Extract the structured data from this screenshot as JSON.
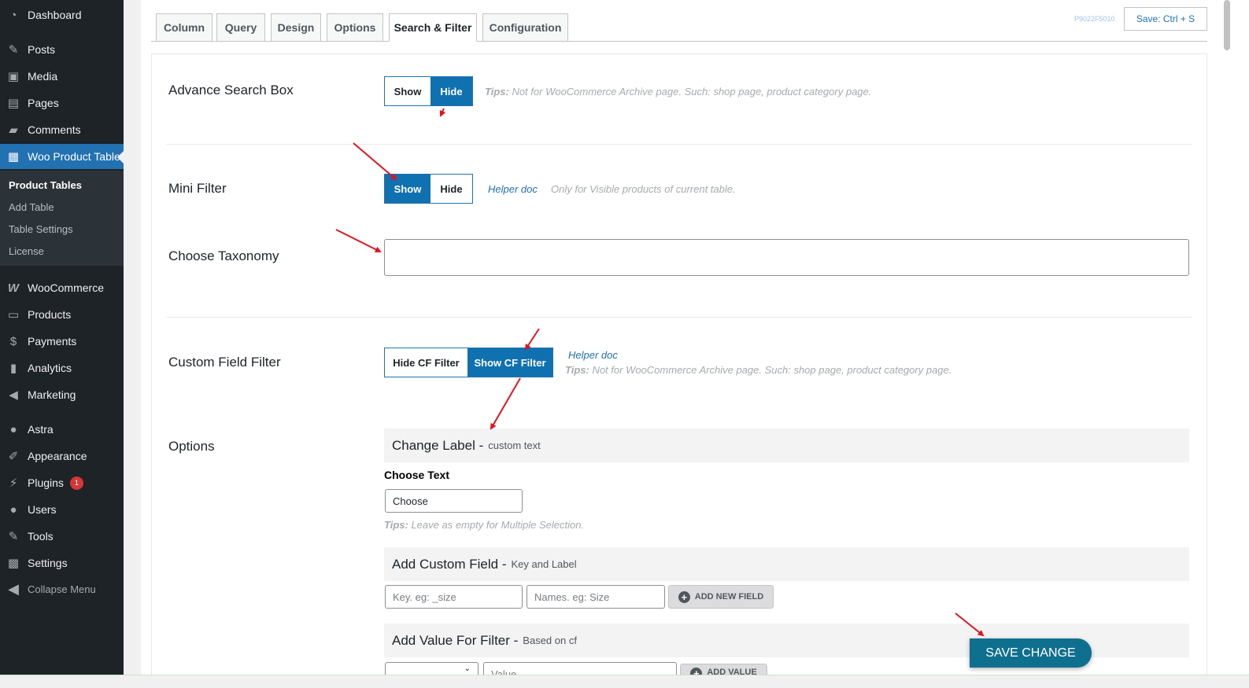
{
  "sidebar": {
    "dashboard": "Dashboard",
    "posts": "Posts",
    "media": "Media",
    "pages": "Pages",
    "comments": "Comments",
    "woo_product_table": "Woo Product Table",
    "submenu": [
      "Product Tables",
      "Add Table",
      "Table Settings",
      "License"
    ],
    "woocommerce": "WooCommerce",
    "products": "Products",
    "payments": "Payments",
    "analytics": "Analytics",
    "marketing": "Marketing",
    "astra": "Astra",
    "appearance": "Appearance",
    "plugins": "Plugins",
    "plugins_badge": "1",
    "users": "Users",
    "tools": "Tools",
    "settings": "Settings",
    "collapse": "Collapse Menu"
  },
  "tabs": [
    "Column",
    "Query",
    "Design",
    "Options",
    "Search & Filter",
    "Configuration"
  ],
  "active_tab": "Search & Filter",
  "header": {
    "code": "P9022F5010",
    "save_shortcut": "Save: Ctrl + S"
  },
  "advance_search": {
    "label": "Advance Search Box",
    "show": "Show",
    "hide": "Hide",
    "selected": "Hide",
    "tips_prefix": "Tips:",
    "tips": " Not for WooCommerce Archive page. Such: shop page, product category page."
  },
  "mini_filter": {
    "label": "Mini Filter",
    "show": "Show",
    "hide": "Hide",
    "selected": "Show",
    "helper": "Helper doc",
    "note": "Only for Visible products of current table."
  },
  "taxonomy": {
    "label": "Choose Taxonomy",
    "value": ""
  },
  "custom_field_filter": {
    "label": "Custom Field Filter",
    "hide": "Hide CF Filter",
    "show": "Show CF Filter",
    "selected": "Show CF Filter",
    "helper": "Helper doc",
    "tips_prefix": "Tips:",
    "tips": " Not for WooCommerce Archive page. Such: shop page, product category page."
  },
  "options": {
    "label": "Options",
    "change_label_title": "Change Label -",
    "change_label_sub": "custom text",
    "choose_text_label": "Choose Text",
    "choose_text_value": "Choose",
    "choose_tips_prefix": "Tips:",
    "choose_tips": " Leave as empty for Multiple Selection.",
    "add_field_title": "Add Custom Field -",
    "add_field_sub": "Key and Label",
    "key_placeholder": "Key. eg: _size",
    "name_placeholder": "Names. eg: Size",
    "add_new_field": "ADD NEW FIELD",
    "add_value_title": "Add Value For Filter -",
    "add_value_sub": "Based on cf",
    "value_placeholder": "Value",
    "add_value": "ADD VALUE"
  },
  "save_change": "SAVE CHANGE",
  "colors": {
    "sidebar_bg": "#1d2327",
    "accent": "#2271b1",
    "toggle_on": "#0f71b0",
    "save_change": "#0f6f8f",
    "annotation_arrow": "#e0141e"
  }
}
